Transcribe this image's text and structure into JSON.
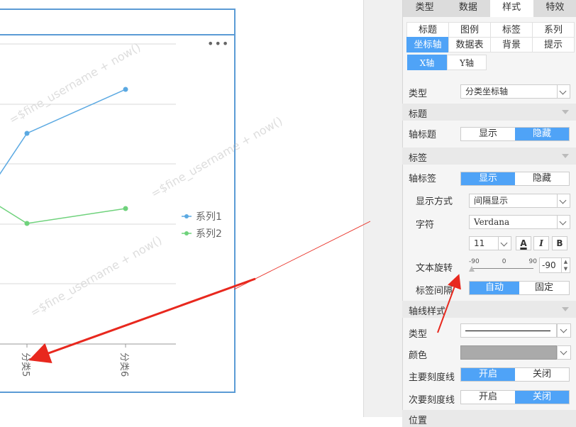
{
  "chart": {
    "more_label": "•••",
    "watermark_text": "=$fine_username + now()",
    "legend": [
      {
        "name": "系列1",
        "color": "#5ba9e2"
      },
      {
        "name": "系列2",
        "color": "#6fd27c"
      }
    ]
  },
  "chart_data": {
    "type": "line",
    "categories": [
      "分类5",
      "分类6"
    ],
    "series": [
      {
        "name": "系列1",
        "values": [
          null,
          null
        ]
      },
      {
        "name": "系列2",
        "values": [
          null,
          null
        ]
      }
    ]
  },
  "panel": {
    "top_tabs": [
      "类型",
      "数据",
      "样式",
      "特效"
    ],
    "active_top_tab": "样式",
    "sub_tabs": [
      "标题",
      "图例",
      "标签",
      "系列",
      "坐标轴",
      "数据表",
      "背景",
      "提示"
    ],
    "active_sub_tab": "坐标轴",
    "axis_tabs": [
      "X轴",
      "Y轴"
    ],
    "type_label": "类型",
    "type_value": "分类坐标轴",
    "section_title": "标题",
    "axis_title_label": "轴标题",
    "show": "显示",
    "hide": "隐藏",
    "section_label": "标签",
    "axis_label_label": "轴标签",
    "display_mode_label": "显示方式",
    "display_mode_value": "间隔显示",
    "font_label": "字符",
    "font_value": "Verdana",
    "font_size": "11",
    "font_color_label": "A",
    "italic_label": "I",
    "bold_label": "B",
    "rotate_label": "文本旋转",
    "slider_min": "-90",
    "slider_mid": "0",
    "slider_max": "90",
    "rotate_value": "-90",
    "interval_label": "标签间隔",
    "auto": "自动",
    "fixed": "固定",
    "section_line_style": "轴线样式",
    "line_type_label": "类型",
    "color_label": "颜色",
    "line_color": "#aaaaaa",
    "major_tick_label": "主要刻度线",
    "minor_tick_label": "次要刻度线",
    "on": "开启",
    "off": "关闭",
    "section_position": "位置",
    "accent_color": "#4fa3f7"
  }
}
